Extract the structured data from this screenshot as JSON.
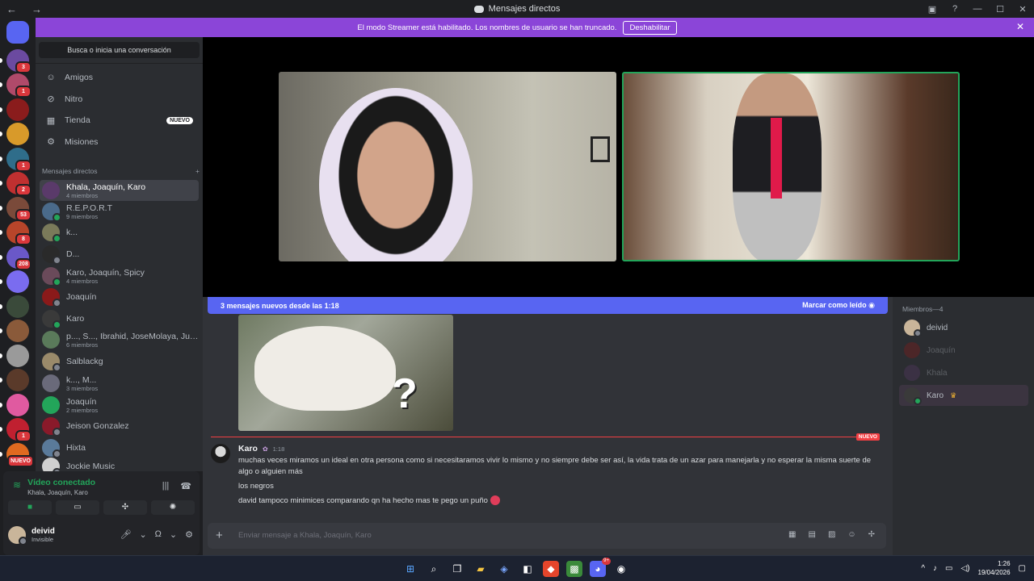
{
  "window": {
    "title": "Mensajes directos"
  },
  "banner": {
    "text": "El modo Streamer está habilitado. Los nombres de usuario se han truncado.",
    "button": "Deshabilitar"
  },
  "guilds": [
    {
      "color": "#5865f2",
      "badge": ""
    },
    {
      "color": "#6b4aa0",
      "badge": "3"
    },
    {
      "color": "#b04a6a",
      "badge": "1"
    },
    {
      "color": "#8a1c1c",
      "badge": ""
    },
    {
      "color": "#d89a2a",
      "badge": ""
    },
    {
      "color": "#2f6d8a",
      "badge": "1"
    },
    {
      "color": "#c03030",
      "badge": "2"
    },
    {
      "color": "#7a4a3a",
      "badge": "53"
    },
    {
      "color": "#b8452a",
      "badge": "8"
    },
    {
      "color": "#6a58c8",
      "badge": "208"
    },
    {
      "color": "#7a6cf0",
      "badge": ""
    },
    {
      "color": "#3a4a3a",
      "badge": ""
    },
    {
      "color": "#8a5a3a",
      "badge": ""
    },
    {
      "color": "#9a9a9a",
      "badge": ""
    },
    {
      "color": "#5a3a2a",
      "badge": ""
    },
    {
      "color": "#e05aa0",
      "badge": ""
    },
    {
      "color": "#c02030",
      "badge": "1"
    },
    {
      "color": "#e06a20",
      "badge": "NUEVO"
    }
  ],
  "sidebar": {
    "search_placeholder": "Busca o inicia una conversación",
    "nav": [
      {
        "label": "Amigos",
        "icon": "friends-icon"
      },
      {
        "label": "Nitro",
        "icon": "nitro-icon"
      },
      {
        "label": "Tienda",
        "icon": "shop-icon",
        "badge": "NUEVO"
      },
      {
        "label": "Misiones",
        "icon": "quests-icon"
      }
    ],
    "dm_header": "Mensajes directos",
    "dms": [
      {
        "name": "Khala, Joaquín, Karo",
        "sub": "4 miembros",
        "color": "#5a3a6a",
        "status": "",
        "selected": true
      },
      {
        "name": "R.E.P.O.R.T",
        "sub": "9 miembros",
        "color": "#4a6a8a",
        "status": "#23a55a"
      },
      {
        "name": "k...",
        "sub": "",
        "color": "#7a7a5a",
        "status": "#23a55a"
      },
      {
        "name": "D...",
        "sub": "",
        "color": "#2a2a2a",
        "status": "#80848e"
      },
      {
        "name": "Karo, Joaquín, Spicy",
        "sub": "4 miembros",
        "color": "#6a4a5a",
        "status": "#23a55a"
      },
      {
        "name": "Joaquín",
        "sub": "",
        "color": "#8a1a1a",
        "status": "#80848e"
      },
      {
        "name": "Karo",
        "sub": "",
        "color": "#3a3a3a",
        "status": "#23a55a"
      },
      {
        "name": "p..., S..., Ibrahid, JoseMolaya, Jud...",
        "sub": "6 miembros",
        "color": "#5a7a5a",
        "status": ""
      },
      {
        "name": "Salblackg",
        "sub": "",
        "color": "#9a8a6a",
        "status": "#80848e"
      },
      {
        "name": "k..., M...",
        "sub": "3 miembros",
        "color": "#6a6a7a",
        "status": ""
      },
      {
        "name": "Joaquín",
        "sub": "2 miembros",
        "color": "#23a55a",
        "status": ""
      },
      {
        "name": "Jeison Gonzalez",
        "sub": "",
        "color": "#8a1a2a",
        "status": "#80848e"
      },
      {
        "name": "Hixta",
        "sub": "",
        "color": "#5a7a9a",
        "status": "#80848e"
      },
      {
        "name": "Jockie Music",
        "sub": "",
        "color": "#d0d0d0",
        "status": "#80848e"
      }
    ]
  },
  "voice": {
    "status": "Vídeo conectado",
    "channel": "Khala, Joaquín, Karo"
  },
  "user": {
    "name": "deivid",
    "status": "Invisible"
  },
  "chat": {
    "new_messages": "3 mensajes nuevos desde las 1:18",
    "mark_read": "Marcar como leído",
    "new_tag": "NUEVO",
    "message": {
      "author": "Karo",
      "time": "1:18",
      "lines": [
        "muchas veces miramos un ideal en otra persona como si necesitaramos vivir lo mismo y no siempre debe ser así, la vida trata de un azar para manejarla y no esperar la misma suerte de algo o alguien más",
        "los negros",
        "david tampoco minimices comparando qn ha hecho mas te pego un puño"
      ]
    },
    "composer_placeholder": "Enviar mensaje a Khala, Joaquín, Karo"
  },
  "members": {
    "header": "Miembros—4",
    "list": [
      {
        "name": "deivid",
        "color": "#c9b59a",
        "status": "#80848e",
        "offline": false
      },
      {
        "name": "Joaquín",
        "color": "#8a1a1a",
        "status": "",
        "offline": true
      },
      {
        "name": "Khala",
        "color": "#5a3a6a",
        "status": "",
        "offline": true
      },
      {
        "name": "Karo",
        "color": "#3a3a3a",
        "status": "#23a55a",
        "offline": false,
        "highlight": true
      }
    ]
  },
  "taskbar": {
    "time": "1:26",
    "date": "19/04/2026",
    "discord_badge": "9+"
  }
}
